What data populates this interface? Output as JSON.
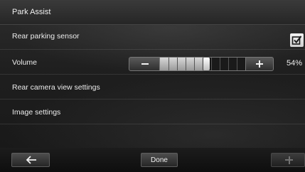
{
  "header": {
    "title": "Park Assist"
  },
  "settings": {
    "rear_sensor": {
      "label": "Rear parking sensor",
      "checked": true
    },
    "volume": {
      "label": "Volume",
      "value": 54,
      "value_text": "54%",
      "segments": 10
    },
    "rear_camera": {
      "label": "Rear camera view settings"
    },
    "image": {
      "label": "Image settings"
    }
  },
  "footer": {
    "back_icon": "arrow-left-icon",
    "done_label": "Done",
    "add_icon": "plus-icon"
  }
}
